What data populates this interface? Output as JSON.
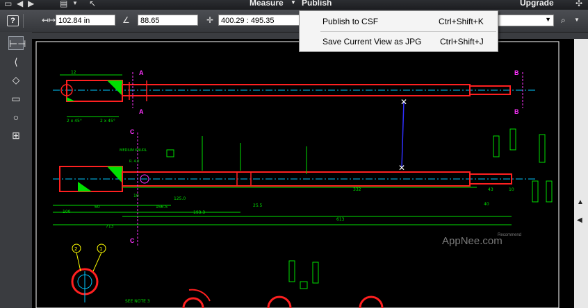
{
  "topbar": {
    "menu_measure": "Measure",
    "menu_publish": "Publish",
    "menu_upgrade": "Upgrade",
    "menu_arrow": "▼"
  },
  "toolbar": {
    "help_label": "?",
    "length_value": "102.84 in",
    "angle_value": "88.65",
    "coords_value": "400.29 : 495.35"
  },
  "publish_menu": {
    "items": [
      {
        "label": "Publish to CSF",
        "shortcut": "Ctrl+Shift+K"
      },
      {
        "label": "Save Current View as JPG",
        "shortcut": "Ctrl+Shift+J"
      }
    ]
  },
  "drawing": {
    "section_labels": [
      "A",
      "A",
      "B",
      "B",
      "C",
      "C"
    ],
    "note_knurl": "MEDIUM KNURL",
    "note_see": "SEE NOTE 3",
    "balloon_1": "1",
    "balloon_2": "2",
    "dims": {
      "d12": "12",
      "d2x45_a": "2 x 45°",
      "d2x45_b": "2 x 45°",
      "d100": "100",
      "d60": "60",
      "d10": "10",
      "d166": "166.5",
      "d1933": "193.3",
      "d713": "713",
      "d613": "613",
      "d332": "332",
      "d255": "25.5",
      "d125": "125.0",
      "d43": "43",
      "d10b": "10",
      "d40": "40",
      "r": "R. 4.0"
    },
    "watermark": "AppNee.com",
    "watermark_sub": "Recommend"
  },
  "colors": {
    "part_outline": "#ff2020",
    "dimension": "#00e000",
    "centerline": "#00c8ff",
    "section_marker": "#ff33ff",
    "measure_line": "#3030ff"
  }
}
